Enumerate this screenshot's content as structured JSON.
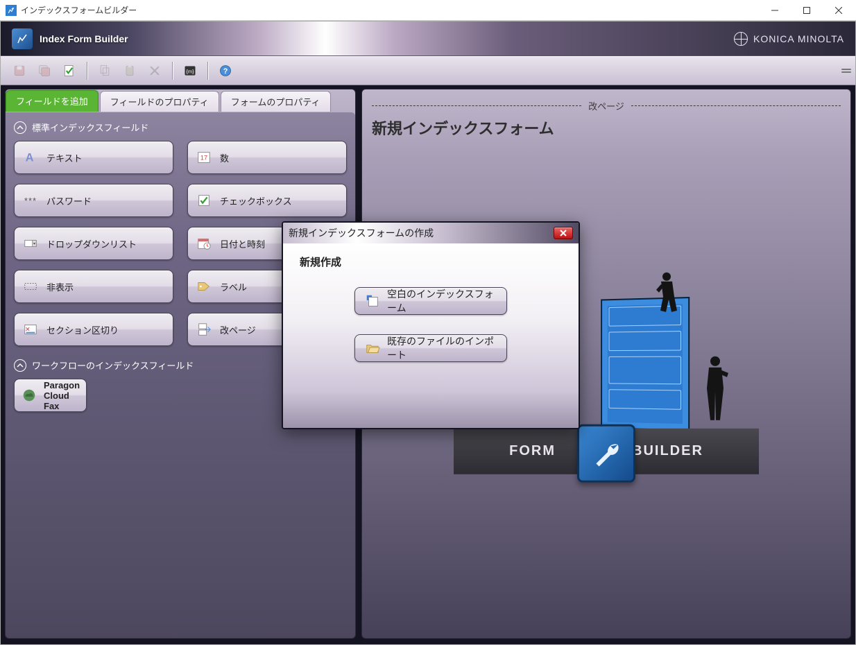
{
  "window": {
    "title": "インデックスフォームビルダー"
  },
  "ribbon": {
    "appTitle": "Index Form Builder",
    "brand": "KONICA MINOLTA"
  },
  "toolbar": {
    "buttons": [
      {
        "name": "save-icon",
        "enabled": false
      },
      {
        "name": "save-as-icon",
        "enabled": false
      },
      {
        "name": "validate-icon",
        "enabled": true
      },
      {
        "name": "copy-icon",
        "enabled": false
      },
      {
        "name": "paste-icon",
        "enabled": false
      },
      {
        "name": "delete-icon",
        "enabled": false
      },
      {
        "name": "metadata-icon",
        "enabled": true
      },
      {
        "name": "help-icon",
        "enabled": true
      }
    ]
  },
  "tabs": {
    "items": [
      {
        "label": "フィールドを追加",
        "active": true
      },
      {
        "label": "フィールドのプロパティ",
        "active": false
      },
      {
        "label": "フォームのプロパティ",
        "active": false
      }
    ]
  },
  "sections": {
    "standard": {
      "title": "標準インデックスフィールド",
      "fields": [
        {
          "label": "テキスト",
          "icon": "text-icon"
        },
        {
          "label": "数",
          "icon": "number-icon"
        },
        {
          "label": "パスワード",
          "icon": "password-icon"
        },
        {
          "label": "チェックボックス",
          "icon": "checkbox-icon"
        },
        {
          "label": "ドロップダウンリスト",
          "icon": "dropdown-icon"
        },
        {
          "label": "日付と時刻",
          "icon": "datetime-icon"
        },
        {
          "label": "非表示",
          "icon": "hidden-icon"
        },
        {
          "label": "ラベル",
          "icon": "label-icon"
        },
        {
          "label": "セクション区切り",
          "icon": "section-icon"
        },
        {
          "label": "改ページ",
          "icon": "pagebreak-icon"
        }
      ]
    },
    "workflow": {
      "title": "ワークフローのインデックスフィールド",
      "fields": [
        {
          "label": "Paragon Cloud Fax",
          "icon": "cloudfax-icon"
        }
      ]
    }
  },
  "preview": {
    "pageBreakLabel": "改ページ",
    "formTitle": "新規インデックスフォーム",
    "heroLeft": "FORM",
    "heroRight": "BUILDER"
  },
  "modal": {
    "title": "新規インデックスフォームの作成",
    "subtitle": "新規作成",
    "blankLabel": "空白のインデックスフォーム",
    "importLabel": "既存のファイルのインポート"
  }
}
